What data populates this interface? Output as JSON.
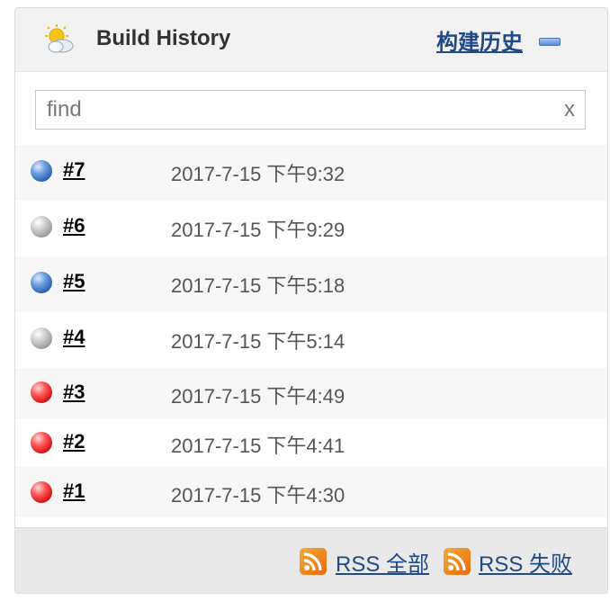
{
  "header": {
    "title": "Build History",
    "trend_link": "构建历史"
  },
  "search": {
    "placeholder": "find",
    "clear_label": "x"
  },
  "builds": [
    {
      "number": "#7",
      "time": "2017-7-15 下午9:32",
      "status": "blue"
    },
    {
      "number": "#6",
      "time": "2017-7-15 下午9:29",
      "status": "grey"
    },
    {
      "number": "#5",
      "time": "2017-7-15 下午5:18",
      "status": "blue"
    },
    {
      "number": "#4",
      "time": "2017-7-15 下午5:14",
      "status": "grey"
    },
    {
      "number": "#3",
      "time": "2017-7-15 下午4:49",
      "status": "red"
    },
    {
      "number": "#2",
      "time": "2017-7-15 下午4:41",
      "status": "red"
    },
    {
      "number": "#1",
      "time": "2017-7-15 下午4:30",
      "status": "red"
    }
  ],
  "footer": {
    "rss_all": "RSS 全部",
    "rss_failed": "RSS 失败"
  },
  "colors": {
    "link": "#204a87",
    "rss": "#f08a24"
  }
}
